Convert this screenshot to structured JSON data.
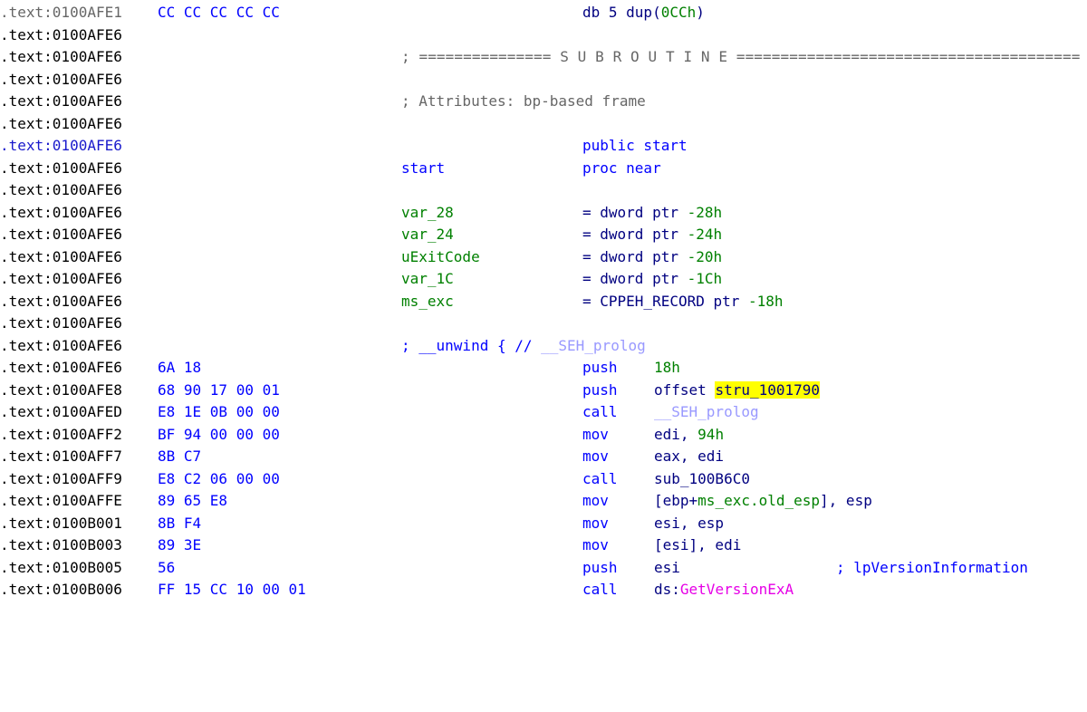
{
  "rows": [
    {
      "addr": ".text:0100AFE1",
      "bytes": "CC CC CC CC CC",
      "mnem": "db 5 dup(",
      "num": "0CCh",
      "tail": ")"
    },
    {
      "addr": ".text:0100AFE6"
    },
    {
      "addr": ".text:0100AFE6",
      "comment": "; =============== S U B R O U T I N E ======================================="
    },
    {
      "addr": ".text:0100AFE6"
    },
    {
      "addr": ".text:0100AFE6",
      "comment": "; Attributes: bp-based frame"
    },
    {
      "addr": ".text:0100AFE6"
    },
    {
      "addr": ".text:0100AFE6",
      "mnem": "public start"
    },
    {
      "addr": ".text:0100AFE6",
      "label": "start",
      "mnem": "proc near"
    },
    {
      "addr": ".text:0100AFE6"
    },
    {
      "addr": ".text:0100AFE6",
      "var": "var_28",
      "eq": "= dword ptr ",
      "num": "-28h"
    },
    {
      "addr": ".text:0100AFE6",
      "var": "var_24",
      "eq": "= dword ptr ",
      "num": "-24h"
    },
    {
      "addr": ".text:0100AFE6",
      "var": "uExitCode",
      "eq": "= dword ptr ",
      "num": "-20h"
    },
    {
      "addr": ".text:0100AFE6",
      "var": "var_1C",
      "eq": "= dword ptr ",
      "num": "-1Ch"
    },
    {
      "addr": ".text:0100AFE6",
      "var": "ms_exc",
      "eq": "= CPPEH_RECORD ptr ",
      "num": "-18h"
    },
    {
      "addr": ".text:0100AFE6"
    },
    {
      "addr": ".text:0100AFE6",
      "unwind": "; __unwind { // ",
      "unwind2": "__SEH_prolog"
    },
    {
      "addr": ".text:0100AFE6",
      "bytes": "6A 18",
      "mnem": "push",
      "num": "18h"
    },
    {
      "addr": ".text:0100AFE8",
      "bytes": "68 90 17 00 01",
      "mnem": "push",
      "op": "offset ",
      "hl": "stru_1001790"
    },
    {
      "addr": ".text:0100AFED",
      "bytes": "E8 1E 0B 00 00",
      "mnem": "call",
      "lav": "__SEH_prolog"
    },
    {
      "addr": ".text:0100AFF2",
      "bytes": "BF 94 00 00 00",
      "mnem": "mov",
      "op": "edi, ",
      "num": "94h"
    },
    {
      "addr": ".text:0100AFF7",
      "bytes": "8B C7",
      "mnem": "mov",
      "op": "eax, edi"
    },
    {
      "addr": ".text:0100AFF9",
      "bytes": "E8 C2 06 00 00",
      "mnem": "call",
      "op": "sub_100B6C0"
    },
    {
      "addr": ".text:0100AFFE",
      "bytes": "89 65 E8",
      "mnem": "mov",
      "op": "[ebp+",
      "green": "ms_exc.old_esp",
      "op2": "], esp"
    },
    {
      "addr": ".text:0100B001",
      "bytes": "8B F4",
      "mnem": "mov",
      "op": "esi, esp"
    },
    {
      "addr": ".text:0100B003",
      "bytes": "89 3E",
      "mnem": "mov",
      "op": "[esi], edi"
    },
    {
      "addr": ".text:0100B005",
      "bytes": "56",
      "mnem": "push",
      "op": "esi",
      "rcmt": "; lpVersionInformation"
    },
    {
      "addr": ".text:0100B006",
      "bytes": "FF 15 CC 10 00 01",
      "mnem": "call",
      "op": "ds:",
      "pink": "GetVersionExA"
    }
  ],
  "selected_row": 6
}
